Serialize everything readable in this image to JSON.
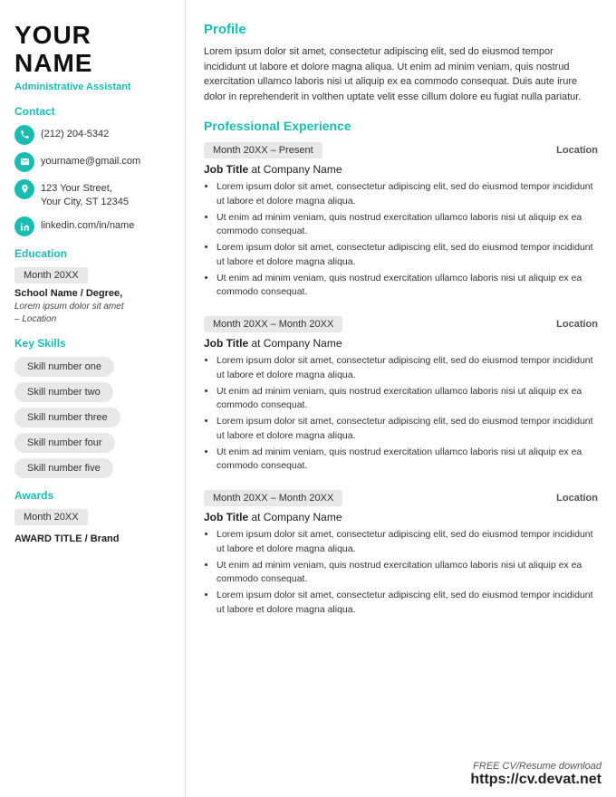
{
  "sidebar": {
    "name_line1": "YOUR",
    "name_line2": "NAME",
    "job_title": "Administrative Assistant",
    "contact_label": "Contact",
    "contacts": [
      {
        "icon": "phone",
        "text": "(212) 204-5342"
      },
      {
        "icon": "email",
        "text": "yourname@gmail.com"
      },
      {
        "icon": "address",
        "text": "123 Your Street,\nYour City, ST 12345"
      },
      {
        "icon": "linkedin",
        "text": "linkedin.com/in/name"
      }
    ],
    "education_label": "Education",
    "education_badge": "Month 20XX",
    "school_name": "School Name / Degree,",
    "school_detail": "Lorem ipsum dolor sit amet\n– Location",
    "skills_label": "Key Skills",
    "skills": [
      "Skill number one",
      "Skill number two",
      "Skill number three",
      "Skill number four",
      "Skill number five"
    ],
    "awards_label": "Awards",
    "awards_badge": "Month 20XX",
    "award_title": "AWARD TITLE / Brand"
  },
  "main": {
    "profile_label": "Profile",
    "profile_text": "Lorem ipsum dolor sit amet, consectetur adipiscing elit, sed do eiusmod tempor incididunt ut labore et dolore magna aliqua. Ut enim ad minim veniam, quis nostrud exercitation ullamco laboris nisi ut aliquip ex ea commodo consequat. Duis aute irure dolor in reprehenderit in volthen uptate velit esse cillum dolore eu fugiat nulla pariatur.",
    "experience_label": "Professional Experience",
    "experiences": [
      {
        "date": "Month 20XX – Present",
        "location": "Location",
        "job_title": "Job Title",
        "company": "at Company Name",
        "bullets": [
          "Lorem ipsum dolor sit amet, consectetur adipiscing elit, sed do eiusmod tempor incididunt ut labore et dolore magna aliqua.",
          "Ut enim ad minim veniam, quis nostrud exercitation ullamco laboris nisi ut aliquip ex ea commodo consequat.",
          "Lorem ipsum dolor sit amet, consectetur adipiscing elit, sed do eiusmod tempor incididunt ut labore et dolore magna aliqua.",
          "Ut enim ad minim veniam, quis nostrud exercitation ullamco laboris nisi ut aliquip ex ea commodo consequat."
        ]
      },
      {
        "date": "Month 20XX – Month 20XX",
        "location": "Location",
        "job_title": "Job Title",
        "company": "at Company Name",
        "bullets": [
          "Lorem ipsum dolor sit amet, consectetur adipiscing elit, sed do eiusmod tempor incididunt ut labore et dolore magna aliqua.",
          "Ut enim ad minim veniam, quis nostrud exercitation ullamco laboris nisi ut aliquip ex ea commodo consequat.",
          "Lorem ipsum dolor sit amet, consectetur adipiscing elit, sed do eiusmod tempor incididunt ut labore et dolore magna aliqua.",
          "Ut enim ad minim veniam, quis nostrud exercitation ullamco laboris nisi ut aliquip ex ea commodo consequat."
        ]
      },
      {
        "date": "Month 20XX – Month 20XX",
        "location": "Location",
        "job_title": "Job Title",
        "company": "at Company Name",
        "bullets": [
          "Lorem ipsum dolor sit amet, consectetur adipiscing elit, sed do eiusmod tempor incididunt ut labore et dolore magna aliqua.",
          "Ut enim ad minim veniam, quis nostrud exercitation ullamco laboris nisi ut aliquip ex ea commodo consequat.",
          "Lorem ipsum dolor sit amet, consectetur adipiscing elit, sed do eiusmod tempor incididunt ut labore et dolore magna aliqua."
        ]
      }
    ]
  },
  "footer": {
    "free_text": "FREE CV/Resume download",
    "url_text": "https://cv.devat.net"
  }
}
